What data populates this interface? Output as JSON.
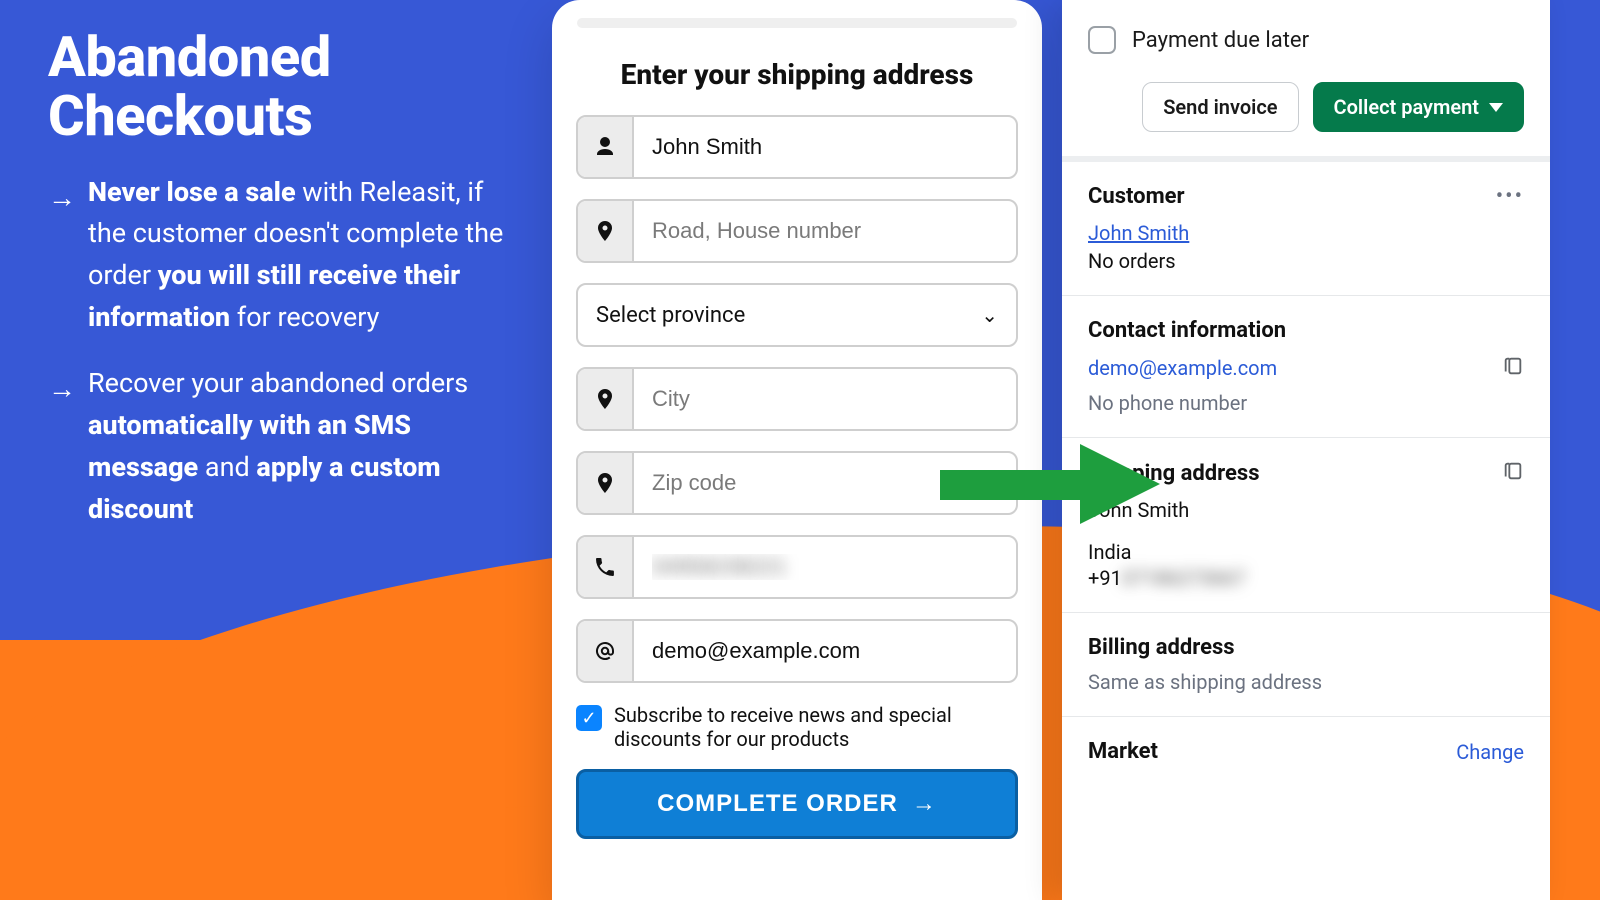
{
  "marketing": {
    "title_line1": "Abandoned",
    "title_line2": "Checkouts",
    "bullets": [
      {
        "prefix_bold": "Never lose a sale",
        "mid": " with Releasit, if the customer doesn't complete the order ",
        "mid_bold": "you will still receive their information",
        "suffix": " for recovery"
      },
      {
        "prefix": "Recover your abandoned orders ",
        "bold1": "automatically with an SMS message",
        "mid2": " and ",
        "bold2": "apply a custom discount"
      }
    ]
  },
  "form": {
    "heading": "Enter your shipping address",
    "name_value": "John Smith",
    "address_placeholder": "Road, House number",
    "province_label": "Select province",
    "city_placeholder": "City",
    "zip_placeholder": "Zip code",
    "phone_value_masked": "04958238221",
    "email_value": "demo@example.com",
    "subscribe_text": "Subscribe to receive news and special discounts for our products",
    "complete_label": "COMPLETE ORDER"
  },
  "admin": {
    "payment_due_later": "Payment due later",
    "send_invoice": "Send invoice",
    "collect_payment": "Collect payment",
    "customer_heading": "Customer",
    "customer_name": "John Smith",
    "customer_orders": "No orders",
    "contact_heading": "Contact information",
    "contact_email": "demo@example.com",
    "no_phone": "No phone number",
    "shipping_heading": "Shipping address",
    "shipping_name": "John Smith",
    "shipping_country": "India",
    "shipping_phone_prefix": "+91",
    "shipping_phone_masked": "07186273667",
    "billing_heading": "Billing address",
    "billing_same": "Same as shipping address",
    "market_heading": "Market",
    "change_label": "Change"
  }
}
